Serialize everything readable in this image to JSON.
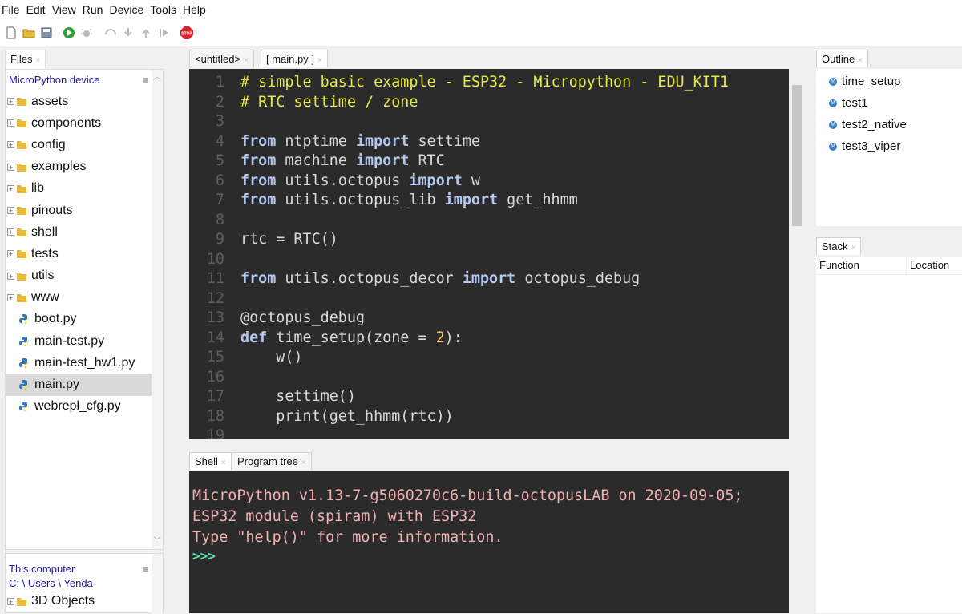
{
  "menu": [
    "File",
    "Edit",
    "View",
    "Run",
    "Device",
    "Tools",
    "Help"
  ],
  "toolbar": {
    "icons": [
      "new-file-icon",
      "open-folder-icon",
      "save-icon",
      "run-icon",
      "debug-icon",
      "step-over-icon",
      "step-into-icon",
      "step-out-icon",
      "resume-icon",
      "stop-icon"
    ],
    "stop_label": "STOP"
  },
  "files": {
    "tab": "Files",
    "header": "MicroPython device",
    "folders": [
      "assets",
      "components",
      "config",
      "examples",
      "lib",
      "pinouts",
      "shell",
      "tests",
      "utils",
      "www"
    ],
    "py_files": [
      "boot.py",
      "main-test.py",
      "main-test_hw1.py",
      "main.py",
      "webrepl_cfg.py"
    ],
    "selected": "main.py",
    "computer_header": "This computer",
    "computer_path": "C: \\ Users \\ Yenda",
    "computer_items": [
      "3D Objects"
    ]
  },
  "editor": {
    "tabs": [
      "<untitled>",
      "[ main.py ]"
    ],
    "lines": [
      "# simple basic example - ESP32 - Micropython - EDU_KIT1",
      "# RTC settime / zone",
      "",
      "from ntptime import settime",
      "from machine import RTC",
      "from utils.octopus import w",
      "from utils.octopus_lib import get_hhmm",
      "",
      "rtc = RTC()",
      "",
      "from utils.octopus_decor import octopus_debug",
      "",
      "@octopus_debug",
      "def time_setup(zone = 2):",
      "    w()",
      "",
      "    settime()",
      "    print(get_hhmm(rtc))",
      ""
    ]
  },
  "shell": {
    "tabs": [
      "Shell",
      "Program tree"
    ],
    "lines": [
      "MicroPython v1.13-7-g5060270c6-build-octopusLAB on 2020-09-05;",
      "ESP32 module (spiram) with ESP32",
      "Type \"help()\" for more information."
    ],
    "prompt": ">>>"
  },
  "outline": {
    "tab": "Outline",
    "items": [
      "time_setup",
      "test1",
      "test2_native",
      "test3_viper"
    ],
    "item_badge": "M"
  },
  "stack": {
    "tab": "Stack",
    "columns": [
      "Function",
      "Location"
    ]
  },
  "colors": {
    "editor_bg": "#2b2b2b",
    "comment": "#e6e94a",
    "keyword": "#b4c8f0",
    "shell_text": "#f0b0b0",
    "prompt": "#5ee6a8",
    "header_blue": "#1a1a9a"
  },
  "close_glyph": "×",
  "menu_glyph": "≡"
}
